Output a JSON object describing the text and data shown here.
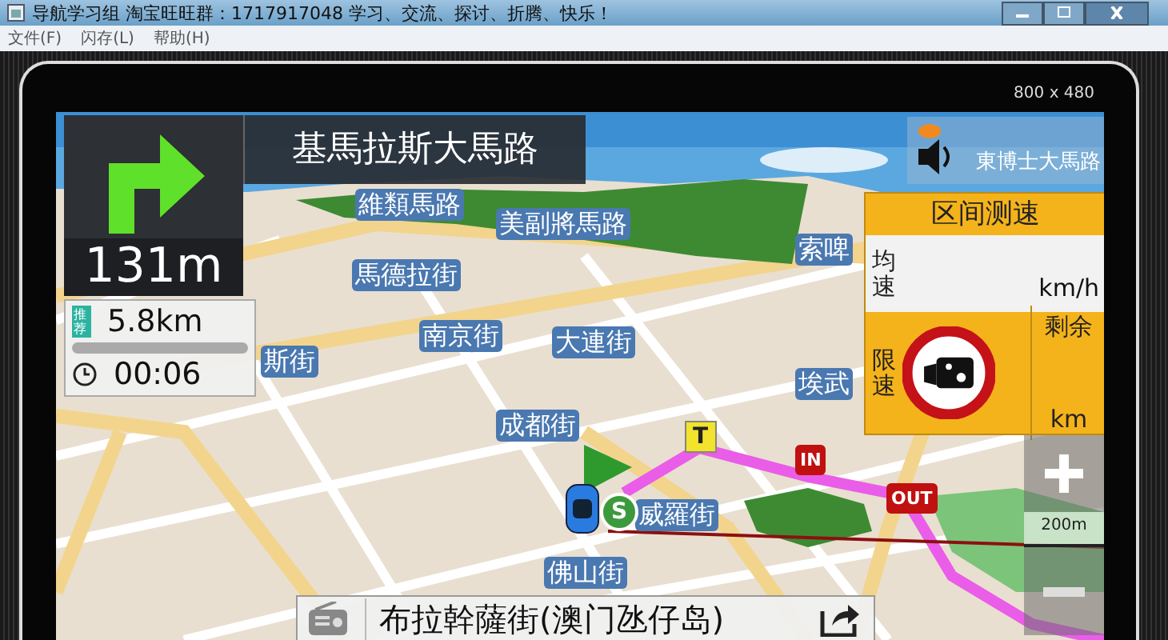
{
  "window": {
    "title": "导航学习组 淘宝旺旺群：1717917048  学习、交流、探讨、折腾、快乐！"
  },
  "menu": [
    "文件(F)",
    "闪存(L)",
    "帮助(H)"
  ],
  "device": {
    "resolution": "800 x 480"
  },
  "guidance": {
    "road": "基馬拉斯大馬路",
    "distance": "131m",
    "badge": "推荐",
    "remaining": "5.8km",
    "level": 0,
    "time": "00:06"
  },
  "next_road": "東博士大馬路",
  "speed_zone": {
    "title": "区间测速",
    "avg_label": "均速",
    "avg_unit": "km/h",
    "limit_label": "限速",
    "remain_label": "剩余",
    "remain_unit": "km"
  },
  "map": {
    "labels": [
      "維類馬路",
      "美副將馬路",
      "馬德拉街",
      "南京街",
      "大連街",
      "斯街",
      "成都街",
      "索啤",
      "埃武",
      "威羅街",
      "佛山街"
    ],
    "markers": [
      {
        "kind": "start",
        "text": "S"
      },
      {
        "kind": "toll",
        "text": "T"
      },
      {
        "kind": "in",
        "text": "IN"
      },
      {
        "kind": "out",
        "text": "OUT"
      }
    ]
  },
  "scale": "200m",
  "destination": "布拉幹薩街(澳门氹仔岛)"
}
